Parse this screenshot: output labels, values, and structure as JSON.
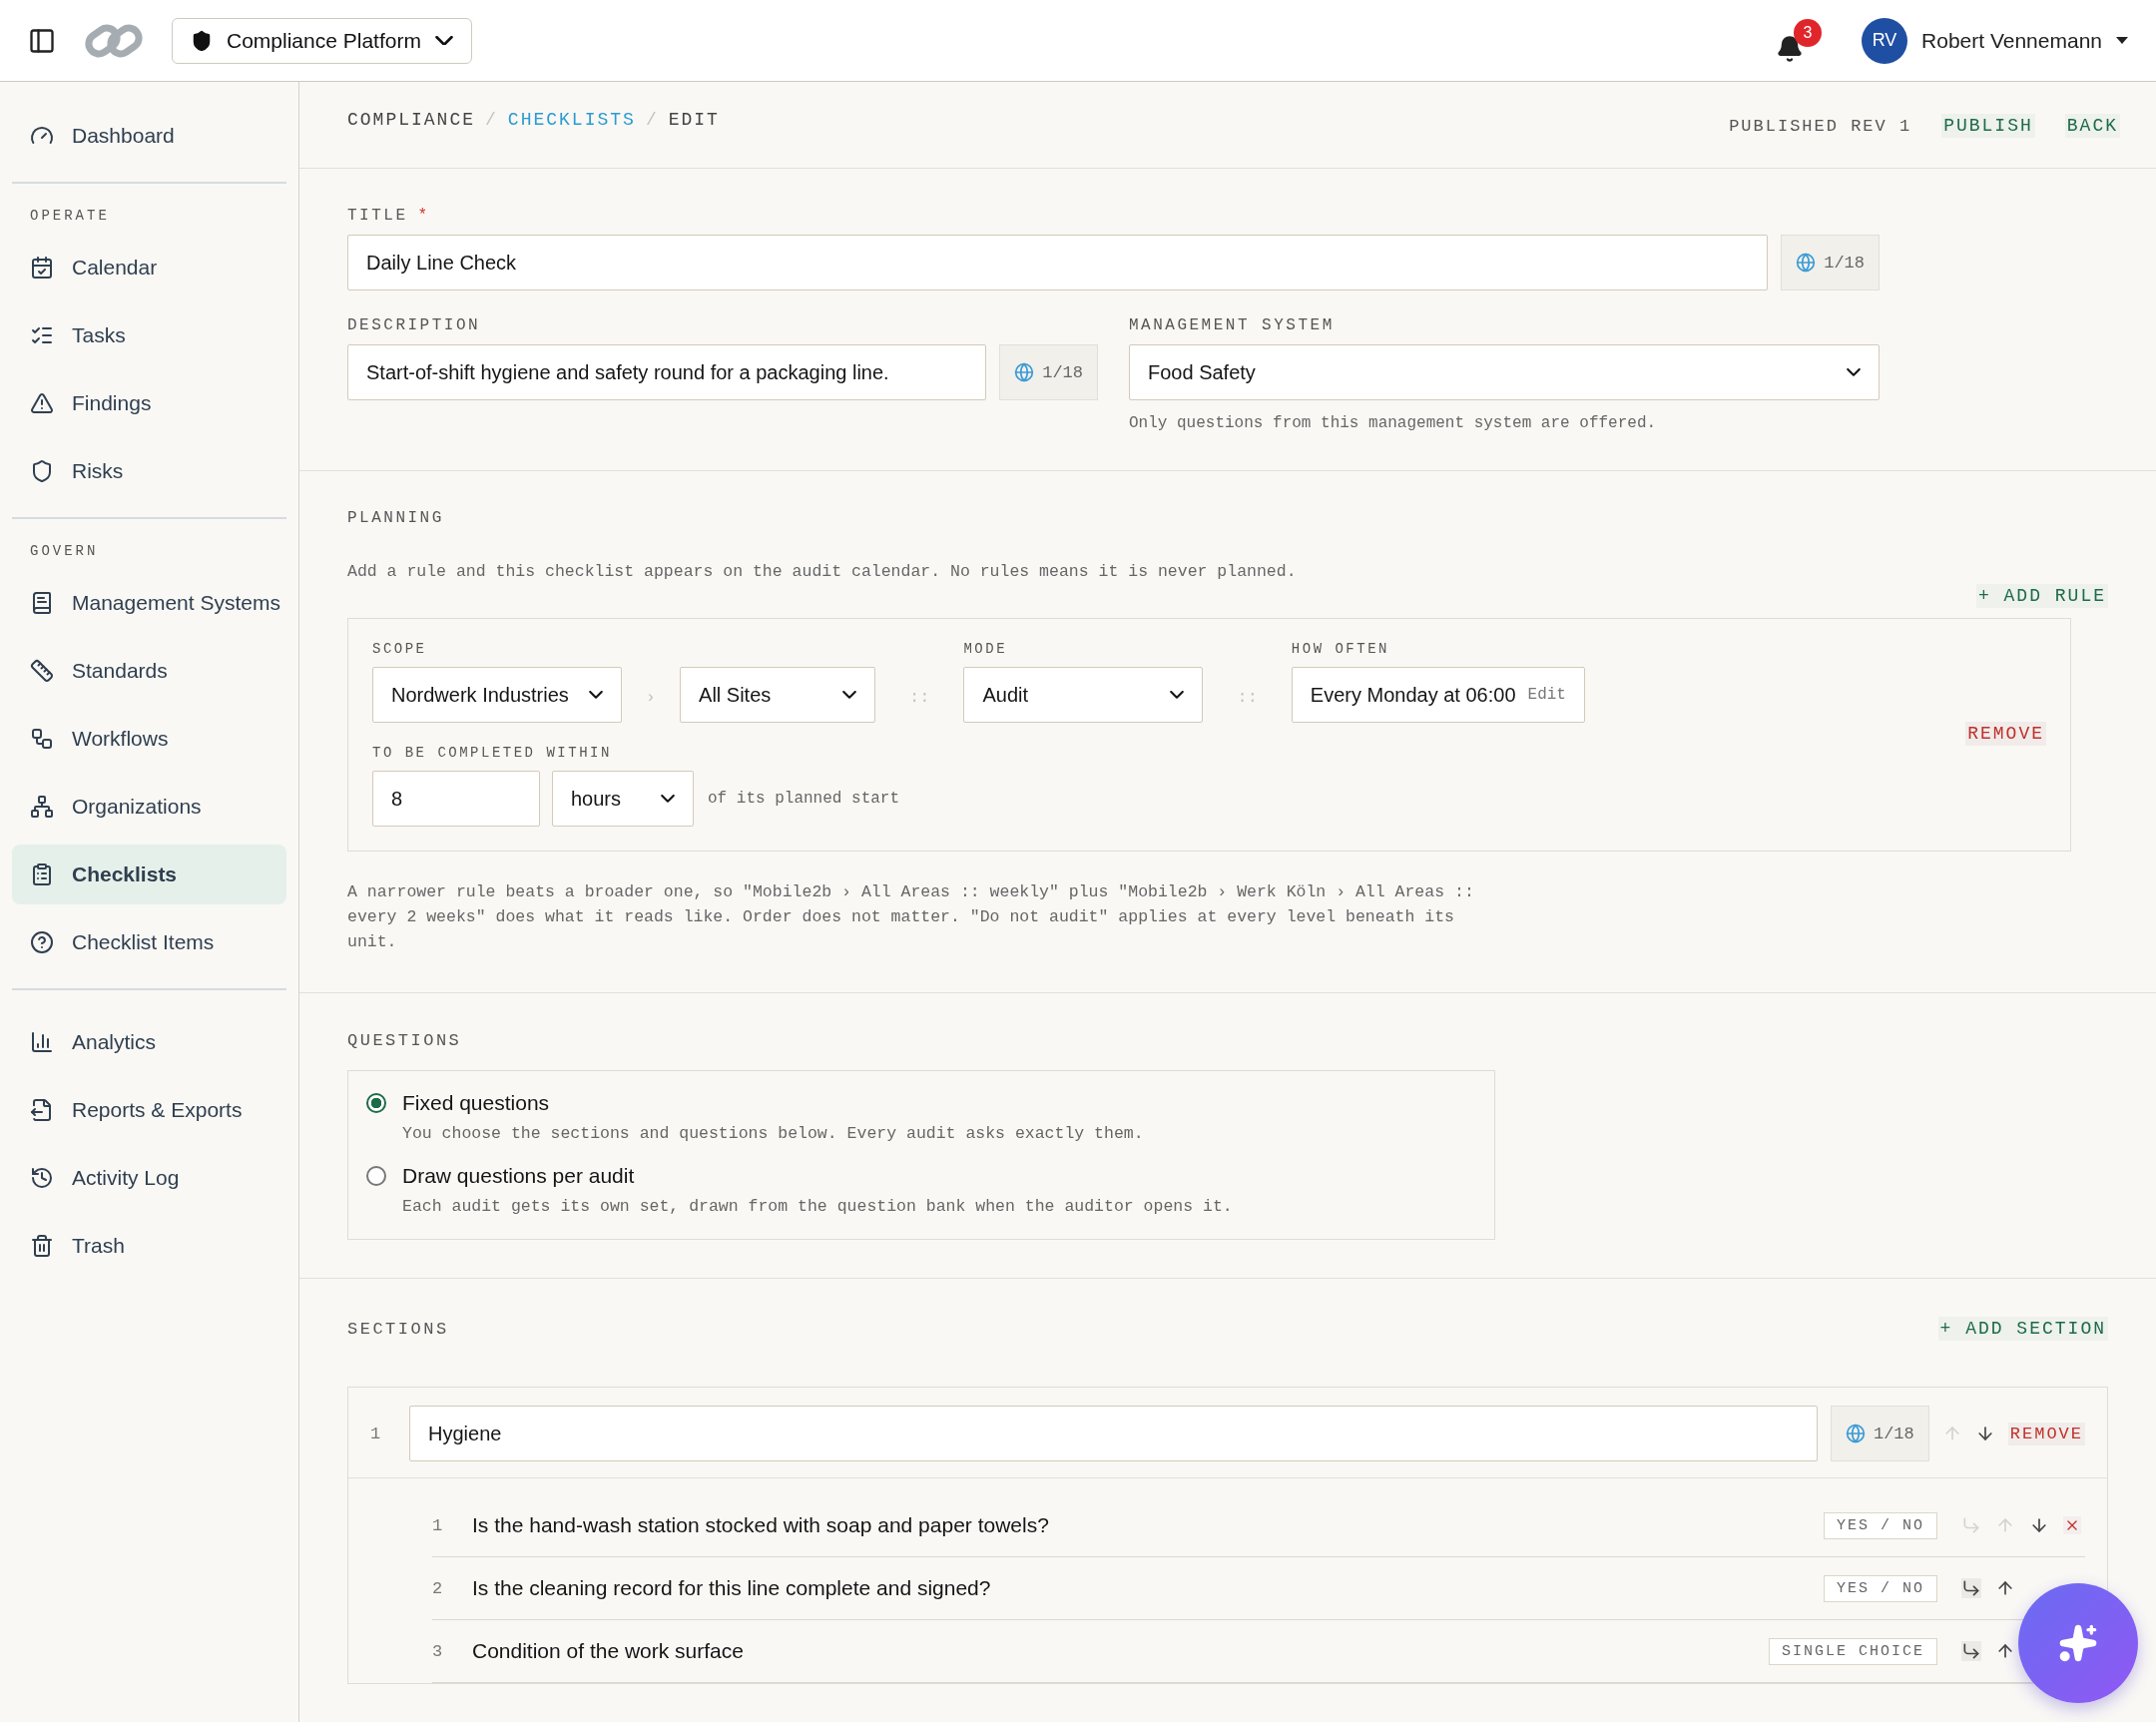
{
  "top_bar": {
    "workspace": "Compliance Platform",
    "notifications": "3",
    "user": {
      "initials": "RV",
      "name": "Robert Vennemann"
    }
  },
  "sidebar": {
    "groups": [
      {
        "items": [
          {
            "label": "Dashboard",
            "selected": false
          }
        ]
      },
      {
        "title": "OPERATE",
        "items": [
          {
            "label": "Calendar",
            "selected": false
          },
          {
            "label": "Tasks",
            "selected": false
          },
          {
            "label": "Findings",
            "selected": false
          },
          {
            "label": "Risks",
            "selected": false
          }
        ]
      },
      {
        "title": "GOVERN",
        "items": [
          {
            "label": "Management Systems",
            "selected": false
          },
          {
            "label": "Standards",
            "selected": false
          },
          {
            "label": "Workflows",
            "selected": false
          },
          {
            "label": "Organizations",
            "selected": false
          },
          {
            "label": "Checklists",
            "selected": true
          },
          {
            "label": "Checklist Items",
            "selected": false
          }
        ]
      },
      {
        "items": [
          {
            "label": "Analytics",
            "selected": false
          },
          {
            "label": "Reports & Exports",
            "selected": false
          },
          {
            "label": "Activity Log",
            "selected": false
          },
          {
            "label": "Trash",
            "selected": false
          }
        ]
      }
    ]
  },
  "header": {
    "breadcrumb": [
      {
        "label": "COMPLIANCE",
        "kind": "crumb"
      },
      {
        "label": "/",
        "kind": "separator"
      },
      {
        "label": "CHECKLISTS",
        "kind": "link"
      },
      {
        "label": "/",
        "kind": "separator"
      },
      {
        "label": "EDIT",
        "kind": "current"
      }
    ],
    "status": "PUBLISHED REV 1",
    "actions": [
      "PUBLISH",
      "BACK"
    ]
  },
  "form": {
    "title": {
      "label": "TITLE",
      "required_mark": "*",
      "value": "Daily Line Check",
      "translations": "1/18"
    },
    "description": {
      "label": "DESCRIPTION",
      "value": "Start-of-shift hygiene and safety round for a packaging line.",
      "translations": "1/18"
    },
    "management_system": {
      "label": "MANAGEMENT SYSTEM",
      "value": "Food Safety",
      "hint": "Only questions from this management system are offered."
    }
  },
  "planning": {
    "title": "PLANNING",
    "intro": "Add a rule and this checklist appears on the audit calendar. No rules means it is never planned.",
    "add_button": "+ ADD RULE",
    "rules": [
      {
        "scope_label": "SCOPE",
        "scope": [
          "Nordwerk Industries",
          "All Sites"
        ],
        "scope_separator": "›",
        "group_separators": [
          "::",
          "::"
        ],
        "mode_label": "MODE",
        "mode": "Audit",
        "frequency_label": "HOW OFTEN",
        "frequency": "Every Monday at 06:00",
        "edit": "Edit",
        "remove": "REMOVE",
        "within_label": "TO BE COMPLETED WITHIN",
        "within_value": "8",
        "within_unit": "hours",
        "within_suffix": "of its planned start"
      }
    ],
    "note": "A narrower rule beats a broader one, so \"Mobile2b › All Areas :: weekly\" plus \"Mobile2b › Werk Köln › All Areas :: every 2 weeks\" does what it reads like. Order does not matter. \"Do not audit\" applies at every level beneath its unit."
  },
  "questions": {
    "title": "QUESTIONS",
    "options": [
      {
        "label": "Fixed questions",
        "description": "You choose the sections and questions below. Every audit asks exactly them.",
        "selected": true
      },
      {
        "label": "Draw questions per audit",
        "description": "Each audit gets its own set, drawn from the question bank when the auditor opens it.",
        "selected": false
      }
    ]
  },
  "sections": {
    "title": "SECTIONS",
    "add_button": "+ ADD SECTION",
    "items": [
      {
        "number": "1",
        "name": "Hygiene",
        "translations": "1/18",
        "up_disabled": true,
        "down_disabled": false,
        "remove": "REMOVE",
        "questions": [
          {
            "number": "1",
            "text": "Is the hand-wash station stocked with soap and paper towels?",
            "type": "YES / NO",
            "actions": [
              {
                "kind": "indent",
                "disabled": true
              },
              {
                "kind": "up",
                "disabled": true
              },
              {
                "kind": "down",
                "disabled": false
              },
              {
                "kind": "delete",
                "disabled": false
              }
            ]
          },
          {
            "number": "2",
            "text": "Is the cleaning record for this line complete and signed?",
            "type": "YES / NO",
            "actions": [
              {
                "kind": "indent",
                "disabled": false
              },
              {
                "kind": "up",
                "disabled": false
              }
            ]
          },
          {
            "number": "3",
            "text": "Condition of the work surface",
            "type": "SINGLE CHOICE",
            "actions": [
              {
                "kind": "indent",
                "disabled": false
              },
              {
                "kind": "up",
                "disabled": false
              }
            ]
          }
        ]
      }
    ]
  }
}
